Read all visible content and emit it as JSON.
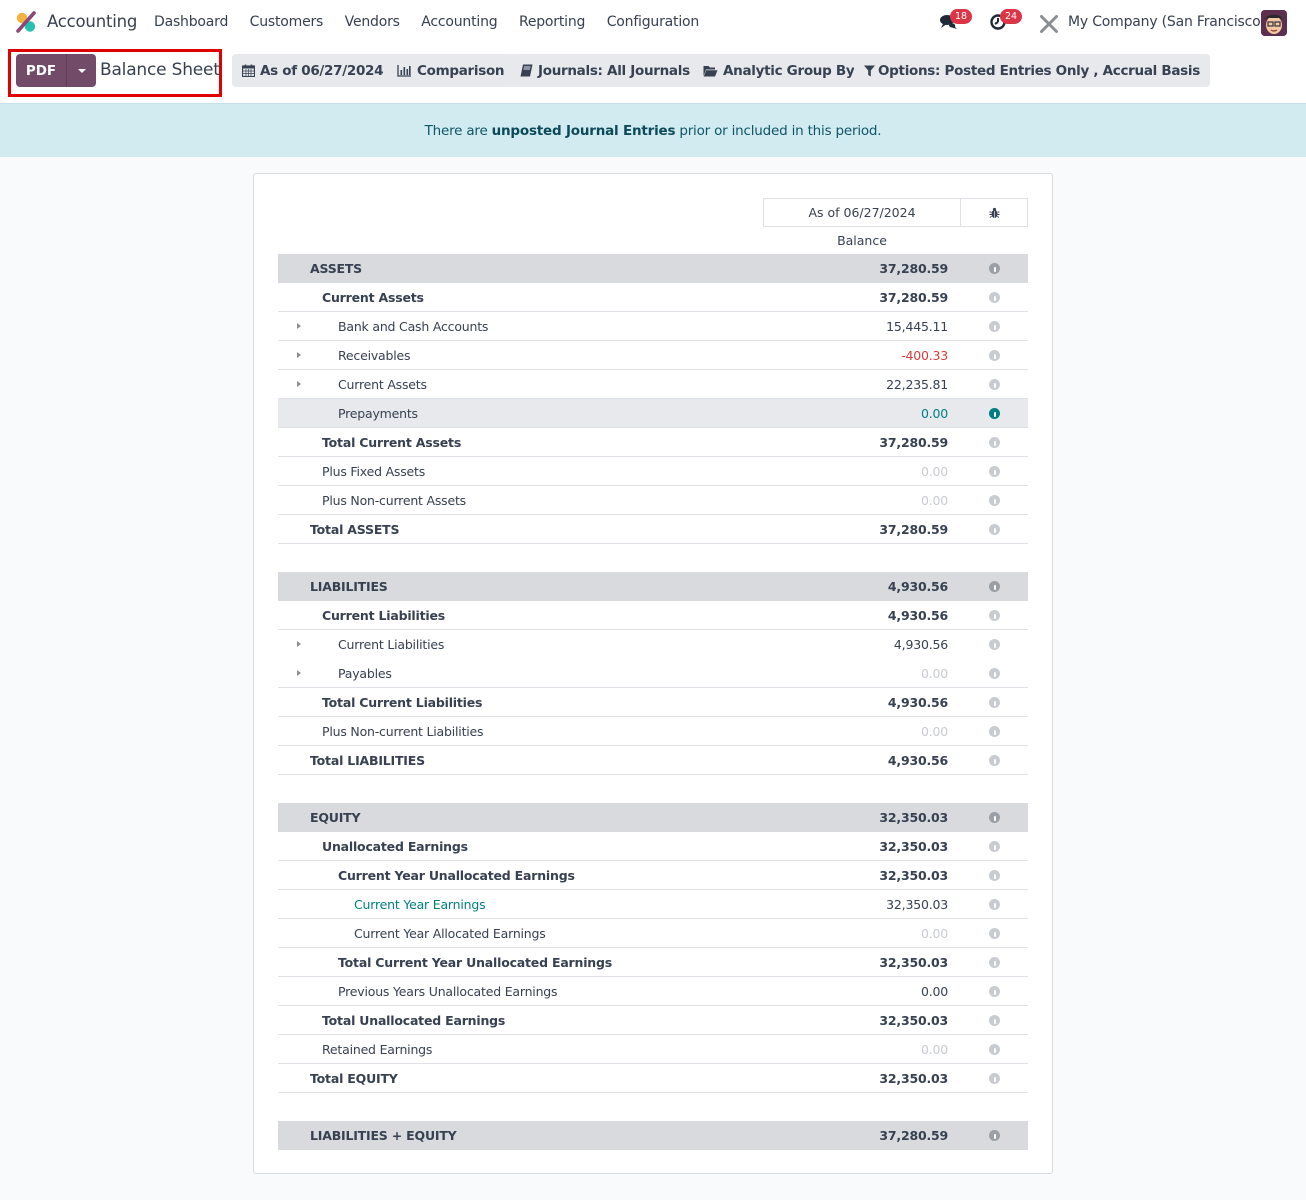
{
  "navbar": {
    "app_name": "Accounting",
    "menu": [
      "Dashboard",
      "Customers",
      "Vendors",
      "Accounting",
      "Reporting",
      "Configuration"
    ],
    "messages_badge": "18",
    "activities_badge": "24",
    "company": "My Company (San Francisco)",
    "icons": {
      "logo": "odoo-accounting-logo",
      "messages": "chat-bubbles-icon",
      "activities": "clock-icon",
      "debug": "wrench-screwdriver-icon",
      "avatar": "user-avatar"
    }
  },
  "controls": {
    "pdf_label": "PDF",
    "report_title": "Balance Sheet",
    "filters": [
      {
        "icon": "calendar-icon",
        "label": "As of 06/27/2024"
      },
      {
        "icon": "bar-chart-icon",
        "label": "Comparison"
      },
      {
        "icon": "book-icon",
        "label": "Journals: All Journals"
      },
      {
        "icon": "folder-open-icon",
        "label": "Analytic Group By"
      },
      {
        "icon": "filter-icon",
        "label": "Options: Posted Entries Only , Accrual Basis"
      }
    ],
    "highlight_color": "#e00000",
    "brand_color": "#714b67"
  },
  "alert": {
    "prefix": "There are",
    "link": "unposted Journal Entries",
    "suffix": "prior or included in this period."
  },
  "report": {
    "column_header": "As of 06/27/2024",
    "column_sub": "Balance",
    "rows": [
      {
        "label": "ASSETS",
        "value": "37,280.59",
        "type": "section",
        "level": 0
      },
      {
        "label": "Current Assets",
        "value": "37,280.59",
        "type": "bold",
        "level": 1
      },
      {
        "label": "Bank and Cash Accounts",
        "value": "15,445.11",
        "type": "account",
        "level": 2,
        "foldable": true
      },
      {
        "label": "Receivables",
        "value": "-400.33",
        "type": "account",
        "level": 2,
        "foldable": true,
        "negative": true
      },
      {
        "label": "Current Assets",
        "value": "22,235.81",
        "type": "account",
        "level": 2,
        "foldable": true
      },
      {
        "label": "Prepayments",
        "value": "0.00",
        "type": "account",
        "level": 2,
        "highlighted": true
      },
      {
        "label": "Total Current Assets",
        "value": "37,280.59",
        "type": "bold",
        "level": 1
      },
      {
        "label": "Plus Fixed Assets",
        "value": "0.00",
        "type": "line",
        "level": 1,
        "zero": true
      },
      {
        "label": "Plus Non-current Assets",
        "value": "0.00",
        "type": "line",
        "level": 1,
        "zero": true
      },
      {
        "label": "Total ASSETS",
        "value": "37,280.59",
        "type": "bold",
        "level": 0
      },
      {
        "type": "spacer"
      },
      {
        "label": "LIABILITIES",
        "value": "4,930.56",
        "type": "section",
        "level": 0
      },
      {
        "label": "Current Liabilities",
        "value": "4,930.56",
        "type": "bold",
        "level": 1
      },
      {
        "label": "Current Liabilities",
        "value": "4,930.56",
        "type": "account",
        "level": 2,
        "foldable": true,
        "noborder": true
      },
      {
        "label": "Payables",
        "value": "0.00",
        "type": "account",
        "level": 2,
        "foldable": true,
        "zero": true
      },
      {
        "label": "Total Current Liabilities",
        "value": "4,930.56",
        "type": "bold",
        "level": 1
      },
      {
        "label": "Plus Non-current Liabilities",
        "value": "0.00",
        "type": "line",
        "level": 1,
        "zero": true
      },
      {
        "label": "Total LIABILITIES",
        "value": "4,930.56",
        "type": "bold",
        "level": 0
      },
      {
        "type": "spacer"
      },
      {
        "label": "EQUITY",
        "value": "32,350.03",
        "type": "section",
        "level": 0
      },
      {
        "label": "Unallocated Earnings",
        "value": "32,350.03",
        "type": "bold",
        "level": 1
      },
      {
        "label": "Current Year Unallocated Earnings",
        "value": "32,350.03",
        "type": "bold",
        "level": 2
      },
      {
        "label": "Current Year Earnings",
        "value": "32,350.03",
        "type": "account",
        "level": 3,
        "link": true
      },
      {
        "label": "Current Year Allocated Earnings",
        "value": "0.00",
        "type": "line",
        "level": 3,
        "zero": true
      },
      {
        "label": "Total Current Year Unallocated Earnings",
        "value": "32,350.03",
        "type": "bold",
        "level": 2
      },
      {
        "label": "Previous Years Unallocated Earnings",
        "value": "0.00",
        "type": "line",
        "level": 2
      },
      {
        "label": "Total Unallocated Earnings",
        "value": "32,350.03",
        "type": "bold",
        "level": 1
      },
      {
        "label": "Retained Earnings",
        "value": "0.00",
        "type": "line",
        "level": 1,
        "zero": true
      },
      {
        "label": "Total EQUITY",
        "value": "32,350.03",
        "type": "bold",
        "level": 0
      },
      {
        "type": "spacer"
      },
      {
        "label": "LIABILITIES + EQUITY",
        "value": "37,280.59",
        "type": "section",
        "level": 0
      }
    ]
  }
}
